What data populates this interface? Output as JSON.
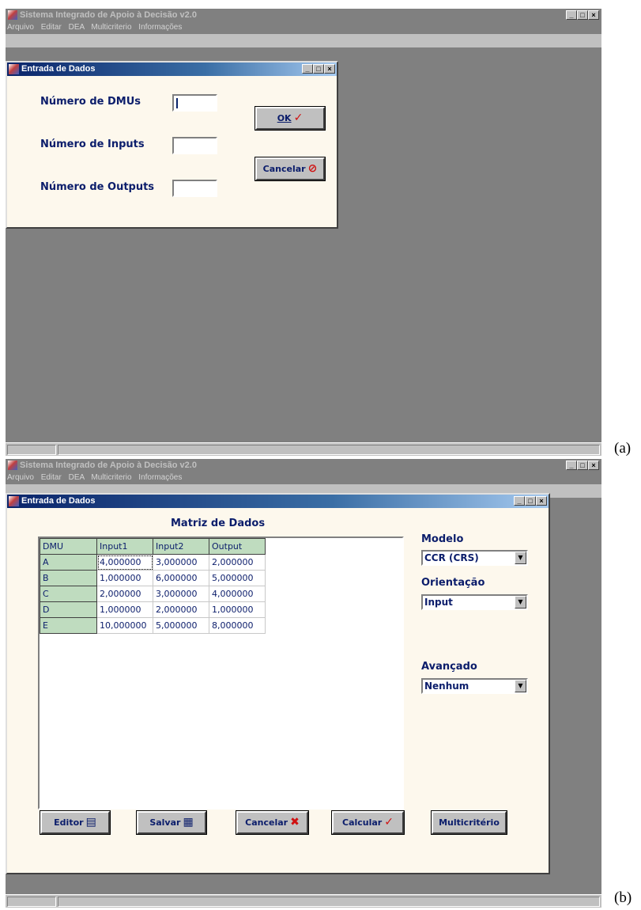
{
  "app": {
    "title": "Sistema Integrado de Apoio à Decisão v2.0",
    "menu": [
      "Arquivo",
      "Editar",
      "DEA",
      "Multicriterio",
      "Informações"
    ],
    "win_buttons": [
      "_",
      "□",
      "×"
    ]
  },
  "panel_a": {
    "label": "(a)",
    "dialog": {
      "title": "Entrada de Dados",
      "fields": [
        {
          "label": "Número de DMUs",
          "value": ""
        },
        {
          "label": "Número de Inputs",
          "value": ""
        },
        {
          "label": "Número de Outputs",
          "value": ""
        }
      ],
      "ok_label": "OK",
      "cancel_label": "Cancelar"
    }
  },
  "panel_b": {
    "label": "(b)",
    "dialog": {
      "title": "Entrada de Dados",
      "matrix_title": "Matriz de Dados",
      "columns": [
        "DMU",
        "Input1",
        "Input2",
        "Output"
      ],
      "rows": [
        [
          "A",
          "4,000000",
          "3,000000",
          "2,000000"
        ],
        [
          "B",
          "1,000000",
          "6,000000",
          "5,000000"
        ],
        [
          "C",
          "2,000000",
          "3,000000",
          "4,000000"
        ],
        [
          "D",
          "1,000000",
          "2,000000",
          "1,000000"
        ],
        [
          "E",
          "10,000000",
          "5,000000",
          "8,000000"
        ]
      ],
      "modelo_label": "Modelo",
      "modelo_value": "CCR (CRS)",
      "orientacao_label": "Orientação",
      "orientacao_value": "Input",
      "avancado_label": "Avançado",
      "avancado_value": "Nenhum",
      "buttons": {
        "editor": "Editor",
        "salvar": "Salvar",
        "cancelar": "Cancelar",
        "calcular": "Calcular",
        "multicriterio": "Multicritério"
      }
    }
  }
}
